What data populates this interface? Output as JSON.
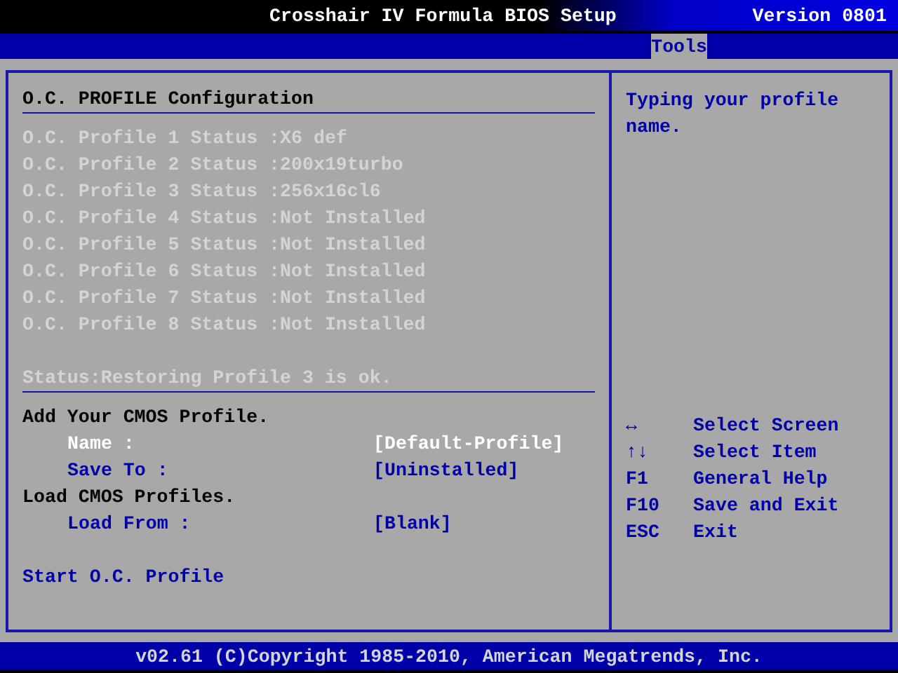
{
  "window": {
    "title": "Crosshair IV Formula BIOS Setup",
    "version": "Version 0801"
  },
  "tabs": [
    {
      "label": "Tools",
      "selected": true
    }
  ],
  "config": {
    "title": "O.C. PROFILE Configuration",
    "profiles": [
      {
        "label": "O.C. Profile 1 Status :X6 def"
      },
      {
        "label": "O.C. Profile 2 Status :200x19turbo"
      },
      {
        "label": "O.C. Profile 3 Status :256x16cl6"
      },
      {
        "label": "O.C. Profile 4 Status :Not Installed"
      },
      {
        "label": "O.C. Profile 5 Status :Not Installed"
      },
      {
        "label": "O.C. Profile 6 Status :Not Installed"
      },
      {
        "label": "O.C. Profile 7 Status :Not Installed"
      },
      {
        "label": "O.C. Profile 8 Status :Not Installed"
      }
    ],
    "status": "Status:Restoring Profile 3 is ok.",
    "items": [
      {
        "kind": "heading",
        "label": "Add Your CMOS Profile."
      },
      {
        "kind": "option",
        "label": "Name :",
        "value": "[Default-Profile]",
        "selected": true
      },
      {
        "kind": "option",
        "label": "Save To :",
        "value": "[Uninstalled]",
        "selected": false
      },
      {
        "kind": "heading",
        "label": "Load CMOS Profiles."
      },
      {
        "kind": "option",
        "label": "Load From :",
        "value": "[Blank]",
        "selected": false
      },
      {
        "kind": "spacer"
      },
      {
        "kind": "action",
        "label": "Start O.C. Profile"
      }
    ]
  },
  "help": {
    "text": "Typing your profile name.",
    "keys": [
      {
        "key": "↔",
        "action": "Select Screen"
      },
      {
        "key": "↑↓",
        "action": "Select Item"
      },
      {
        "key": "F1",
        "action": "General Help"
      },
      {
        "key": "F10",
        "action": "Save and Exit"
      },
      {
        "key": "ESC",
        "action": "Exit"
      }
    ]
  },
  "footer": "v02.61 (C)Copyright 1985-2010, American Megatrends, Inc."
}
